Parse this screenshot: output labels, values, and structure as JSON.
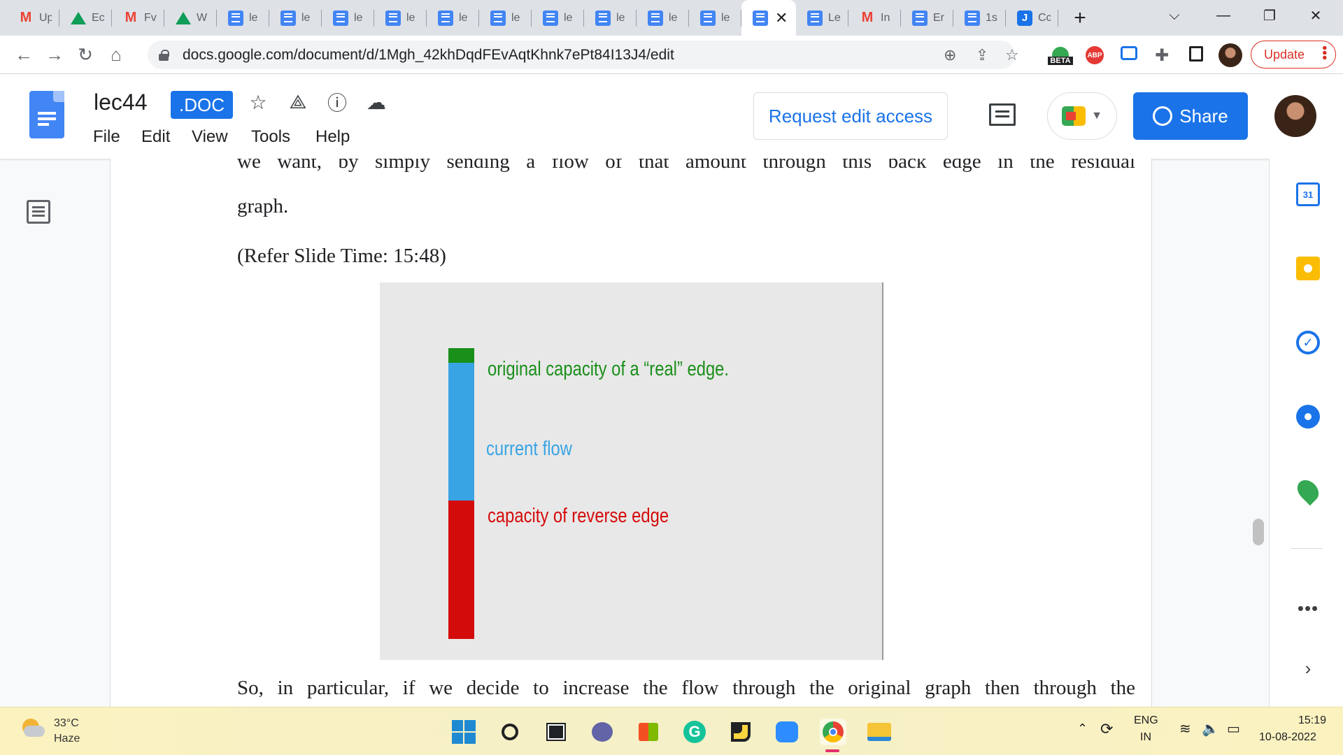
{
  "browser": {
    "tabs": [
      {
        "icon": "gmail-icon",
        "label": "Up"
      },
      {
        "icon": "drive-icon",
        "label": "Ec"
      },
      {
        "icon": "gmail-icon",
        "label": "Fv"
      },
      {
        "icon": "drive-icon",
        "label": "W"
      },
      {
        "icon": "docs-icon",
        "label": "le"
      },
      {
        "icon": "docs-icon",
        "label": "le"
      },
      {
        "icon": "docs-icon",
        "label": "le"
      },
      {
        "icon": "docs-icon",
        "label": "le"
      },
      {
        "icon": "docs-icon",
        "label": "le"
      },
      {
        "icon": "docs-icon",
        "label": "le"
      },
      {
        "icon": "docs-icon",
        "label": "le"
      },
      {
        "icon": "docs-icon",
        "label": "le"
      },
      {
        "icon": "docs-icon",
        "label": "le"
      },
      {
        "icon": "docs-icon",
        "label": "le"
      },
      {
        "icon": "docs-icon",
        "label": "",
        "active": true
      },
      {
        "icon": "docs-icon",
        "label": "Le"
      },
      {
        "icon": "gmail-icon",
        "label": "In"
      },
      {
        "icon": "docs-icon",
        "label": "Er"
      },
      {
        "icon": "docs-icon",
        "label": "1s"
      },
      {
        "icon": "j-icon",
        "label": "Cc"
      }
    ],
    "active_tab_close": "✕",
    "new_tab": "+",
    "window_controls": {
      "dropdown": "⌵",
      "minimize": "—",
      "restore": "❐",
      "close": "✕"
    },
    "url": "docs.google.com/document/d/1Mgh_42khDqdFEvAqtKhnk7ePt84I13J4/edit",
    "beta_label": "BETA",
    "abp_label": "ABP",
    "update_label": "Update"
  },
  "docs": {
    "title": "lec44",
    "badge": ".DOC",
    "menu": [
      "File",
      "Edit",
      "View",
      "Tools",
      "Help"
    ],
    "request_edit_label": "Request edit access",
    "share_label": "Share"
  },
  "document": {
    "para_top": "we want, by simply sending a flow of that amount through this back edge in the residual",
    "para_top_end": "graph.",
    "refer": "(Refer Slide Time: 15:48)",
    "para_bottom": "So, in particular, if we decide to increase the flow through the original graph then through the"
  },
  "slide": {
    "labels": {
      "original": "original capacity of a “real” edge.",
      "current": "current flow",
      "reverse": "capacity of reverse edge"
    },
    "colors": {
      "original": "#1a8f1a",
      "current": "#38a4e4",
      "reverse": "#d40b0b"
    }
  },
  "sidepanel": {
    "calendar_day": "31",
    "more": "•••",
    "collapse": "›"
  },
  "taskbar": {
    "temperature": "33°C",
    "weather": "Haze",
    "lang": "ENG",
    "region": "IN",
    "time": "15:19",
    "date": "10-08-2022"
  }
}
